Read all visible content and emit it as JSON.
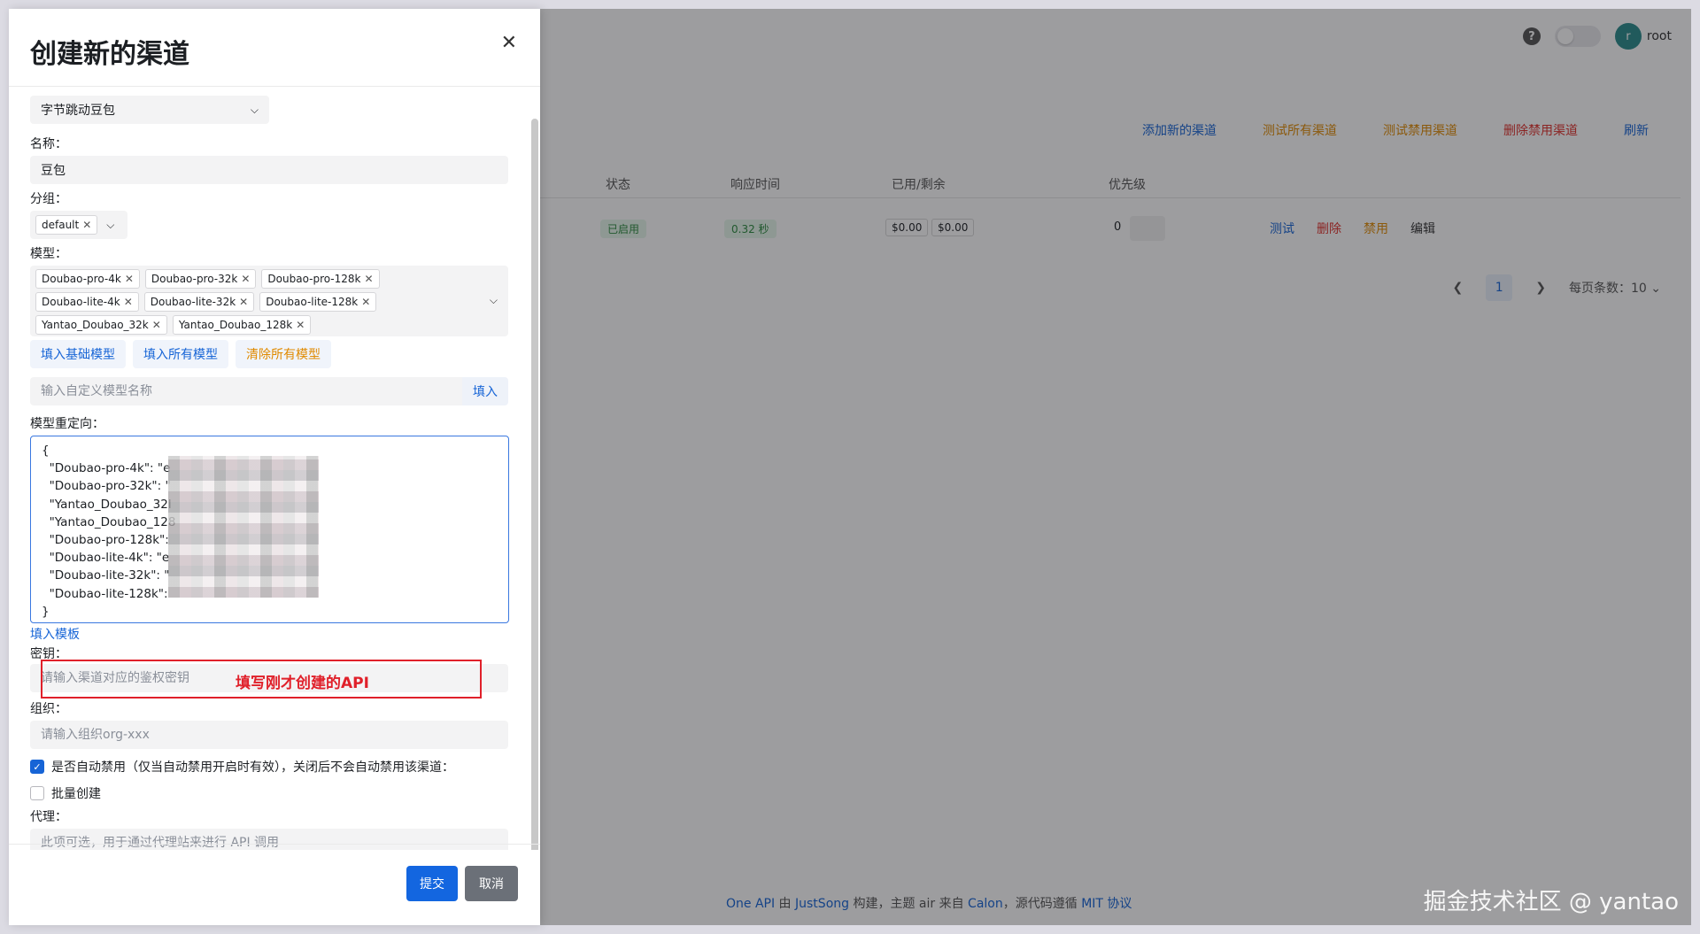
{
  "background": {
    "user": {
      "avatar_letter": "r",
      "name": "root"
    },
    "actions": {
      "add_channel": "添加新的渠道",
      "test_all": "测试所有渠道",
      "test_disabled": "测试禁用渠道",
      "delete_disabled": "删除禁用渠道",
      "refresh": "刷新"
    },
    "table": {
      "headers": {
        "status": "状态",
        "response_time": "响应时间",
        "used_remaining": "已用/剩余",
        "priority": "优先级"
      },
      "row": {
        "status": "已启用",
        "response_time": "0.32 秒",
        "used": "$0.00",
        "remaining": "$0.00",
        "priority": "0",
        "actions": {
          "test": "测试",
          "delete": "删除",
          "disable": "禁用",
          "edit": "编辑"
        }
      }
    },
    "pager": {
      "current_page": "1",
      "page_size_label": "每页条数：10"
    },
    "footer": {
      "p1": "One API",
      "t1": " 由 ",
      "p2": "JustSong",
      "t2": " 构建，主题 air 来自 ",
      "p3": "Calon",
      "t3": "，源代码遵循 ",
      "p4": "MIT 协议"
    }
  },
  "watermark": "掘金技术社区 @ yantao",
  "modal": {
    "title": "创建新的渠道",
    "type_select": "字节跳动豆包",
    "name_label": "名称：",
    "name_value": "豆包",
    "group_label": "分组：",
    "group_tag": "default",
    "models_label": "模型：",
    "models": [
      [
        "Doubao-pro-4k",
        "Doubao-pro-32k",
        "Doubao-pro-128k"
      ],
      [
        "Doubao-lite-4k",
        "Doubao-lite-32k",
        "Doubao-lite-128k"
      ],
      [
        "Yantao_Doubao_32k",
        "Yantao_Doubao_128k"
      ]
    ],
    "fill_basic": "填入基础模型",
    "fill_all": "填入所有模型",
    "clear_all": "清除所有模型",
    "custom_model_placeholder": "输入自定义模型名称",
    "custom_model_fill": "填入",
    "mapping_label": "模型重定向：",
    "mapping_lines": [
      "{",
      "  \"Doubao-pro-4k\": \"e",
      "  \"Doubao-pro-32k\": \"",
      "  \"Yantao_Doubao_32l",
      "  \"Yantao_Doubao_128",
      "  \"Doubao-pro-128k\":",
      "  \"Doubao-lite-4k\": \"e",
      "  \"Doubao-lite-32k\": \"",
      "  \"Doubao-lite-128k\":",
      "}"
    ],
    "fill_template": "填入模板",
    "key_label": "密钥：",
    "key_placeholder": "请输入渠道对应的鉴权密钥",
    "annotation": "填写刚才创建的API",
    "org_label": "组织：",
    "org_placeholder": "请输入组织org-xxx",
    "auto_ban_label": "是否自动禁用（仅当自动禁用开启时有效），关闭后不会自动禁用该渠道：",
    "batch_label": "批量创建",
    "proxy_label": "代理：",
    "proxy_placeholder": "此项可选，用于通过代理站来进行 API 调用",
    "submit": "提交",
    "cancel": "取消"
  }
}
